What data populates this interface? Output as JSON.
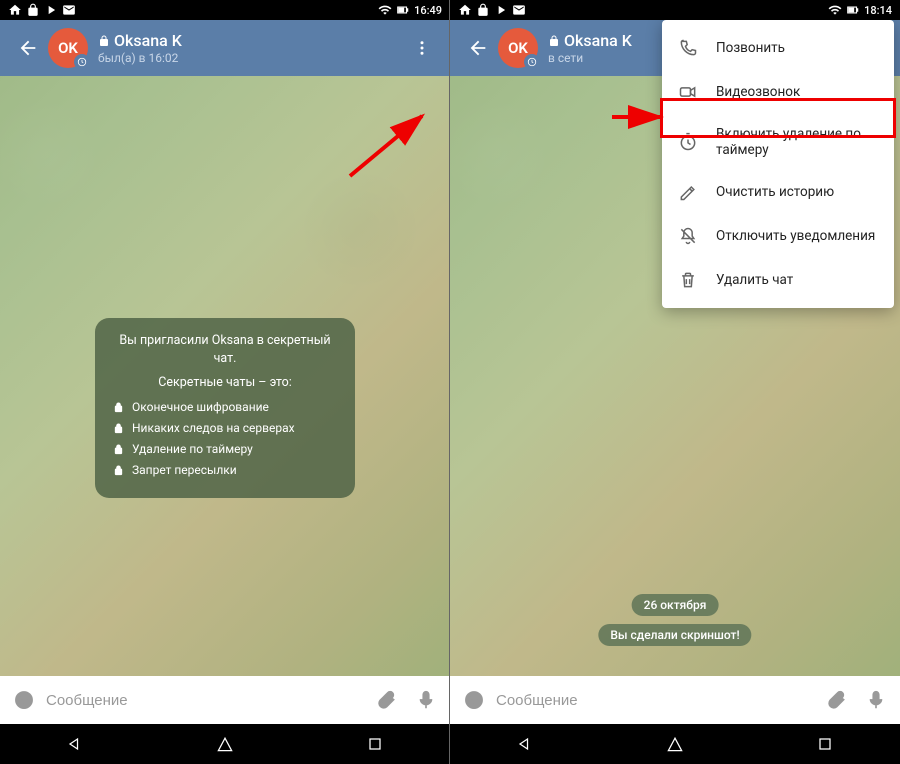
{
  "left": {
    "status_time": "16:49",
    "avatar_initials": "OK",
    "contact_name": "Oksana K",
    "contact_status": "был(а) в 16:02",
    "secret": {
      "invite_line": "Вы пригласили Oksana в секретный чат.",
      "subtitle": "Секретные чаты – это:",
      "items": [
        "Оконечное шифрование",
        "Никаких следов на серверах",
        "Удаление по таймеру",
        "Запрет пересылки"
      ]
    },
    "input_placeholder": "Сообщение"
  },
  "right": {
    "status_time": "18:14",
    "avatar_initials": "OK",
    "contact_name": "Oksana K",
    "contact_status": "в сети",
    "menu": [
      "Позвонить",
      "Видеозвонок",
      "Включить удаление по таймеру",
      "Очистить историю",
      "Отключить уведомления",
      "Удалить чат"
    ],
    "date_pill": "26 октября",
    "screenshot_pill": "Вы сделали скриншот!",
    "input_placeholder": "Сообщение"
  }
}
